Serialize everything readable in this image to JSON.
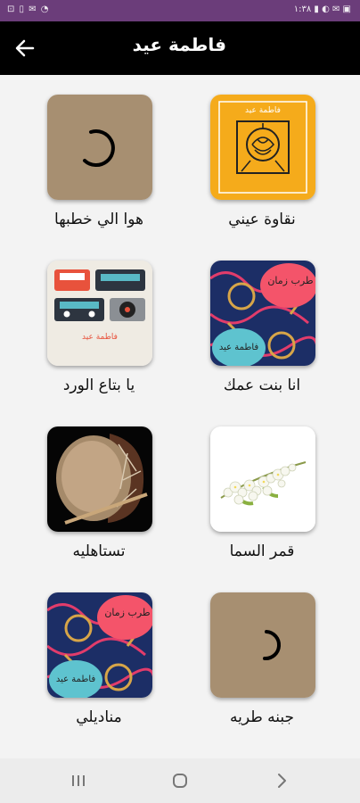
{
  "status": {
    "left_icons": "⊡ ▯ ✉ ◔",
    "right_text": "١:٣٨ ▮ ◐ ✉ ▣"
  },
  "header": {
    "title": "فاطمة عيد",
    "back_icon": "arrow-left-icon"
  },
  "songs": [
    {
      "title": "نقاوة عيني",
      "cover_text": "فاطمة عيد"
    },
    {
      "title": "هوا الي خطبها"
    },
    {
      "title": "انا بنت عمك",
      "cover_text": "طرب زمان",
      "cover_text2": "فاطمة عيد"
    },
    {
      "title": "يا بتاع الورد",
      "cover_text": "فاطمة عيد"
    },
    {
      "title": "قمر السما"
    },
    {
      "title": "تستاهليه"
    },
    {
      "title": "جبنه طريه"
    },
    {
      "title": "مناديلي",
      "cover_text": "طرب زمان",
      "cover_text2": "فاطمة عيد"
    }
  ],
  "nav": {
    "recents_icon": "recents-icon",
    "home_icon": "home-icon",
    "back_icon": "back-chevron-icon"
  },
  "colors": {
    "status_bar": "#6b3d7a",
    "app_bar": "#000000",
    "accent_yellow": "#f5ab1b",
    "loading_bg": "#a78f71"
  }
}
